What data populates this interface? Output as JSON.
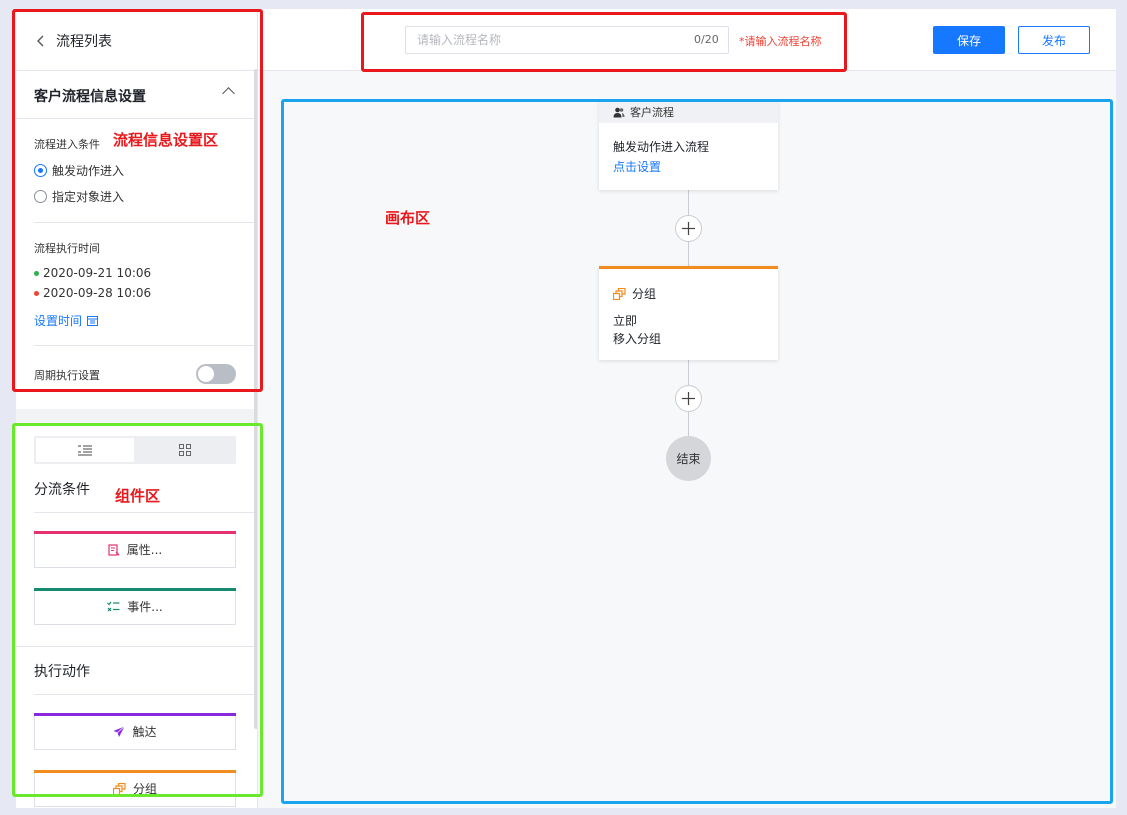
{
  "sidebar": {
    "back_label": "流程列表",
    "section_title": "客户流程信息设置",
    "entry_condition_label": "流程进入条件",
    "entry_options": [
      {
        "label": "触发动作进入",
        "selected": true
      },
      {
        "label": "指定对象进入",
        "selected": false
      }
    ],
    "exec_time_label": "流程执行时间",
    "start_time": "2020-09-21 10:06",
    "end_time": "2020-09-28 10:06",
    "set_time_link": "设置时间",
    "periodic_label": "周期执行设置",
    "periodic_enabled": false
  },
  "components": {
    "view_tabs": [
      "list-icon",
      "grid-icon"
    ],
    "split_title": "分流条件",
    "split_items": [
      {
        "label": "属性...",
        "color": "#e5326f",
        "icon": "attribute-icon"
      },
      {
        "label": "事件...",
        "color": "#168a6e",
        "icon": "event-icon"
      }
    ],
    "action_title": "执行动作",
    "action_items": [
      {
        "label": "触达",
        "color": "#8a28e0",
        "icon": "send-icon"
      },
      {
        "label": "分组",
        "color": "#f28c1f",
        "icon": "group-icon"
      }
    ]
  },
  "header": {
    "name_placeholder": "请输入流程名称",
    "name_value": "",
    "counter": "0/20",
    "warning": "*请输入流程名称",
    "save_label": "保存",
    "publish_label": "发布"
  },
  "canvas": {
    "start_card": {
      "head": "客户流程",
      "title": "触发动作进入流程",
      "link": "点击设置"
    },
    "group_card": {
      "title": "分组",
      "line1": "立即",
      "line2": "移入分组",
      "accent": "#f28c1f"
    },
    "end_label": "结束"
  },
  "annotations": {
    "info_zone": "流程信息设置区",
    "canvas_zone": "画布区",
    "component_zone": "组件区"
  },
  "colors": {
    "primary": "#1677ff",
    "start_dot": "#2bb24c",
    "end_dot": "#f04134",
    "highlight_red": "#e8181c",
    "highlight_green": "#6ae82b",
    "highlight_blue": "#1aa3ee"
  }
}
